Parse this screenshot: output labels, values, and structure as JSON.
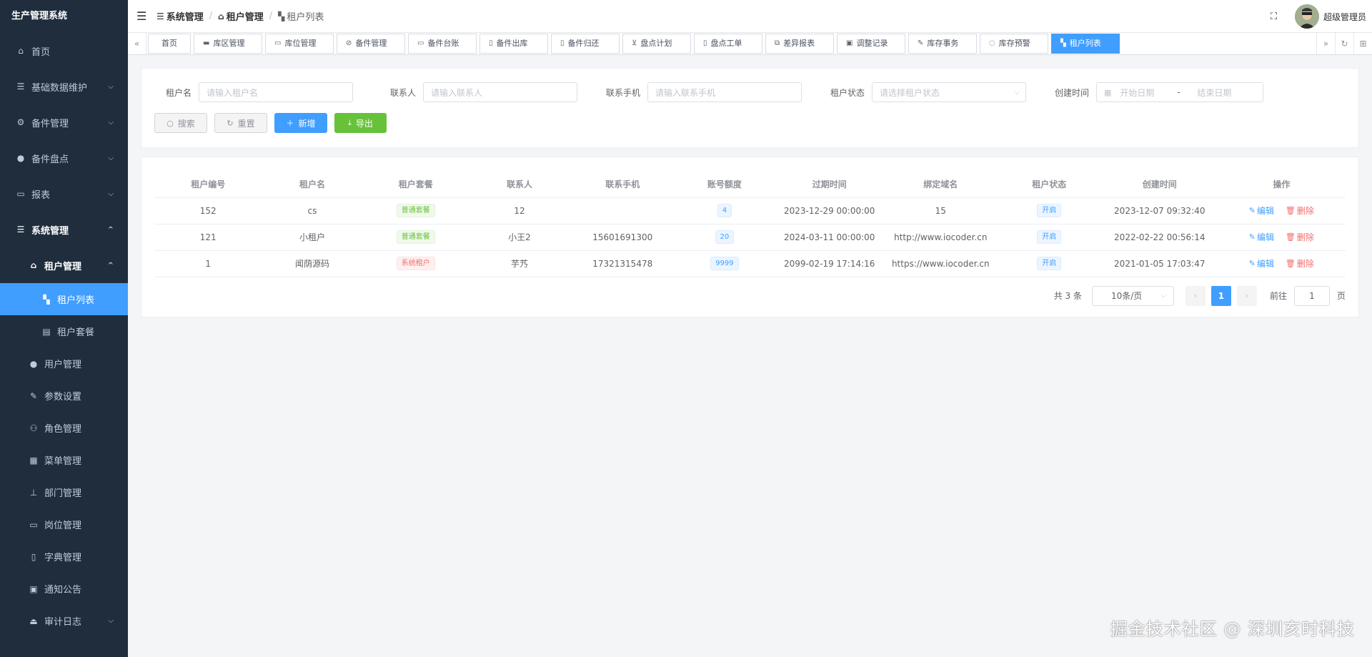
{
  "app": {
    "title": "生产管理系统"
  },
  "sidebar": {
    "items": [
      {
        "label": "首页",
        "icon": "home-icon"
      },
      {
        "label": "基础数据维护",
        "icon": "list-icon"
      },
      {
        "label": "备件管理",
        "icon": "spare-parts-icon"
      },
      {
        "label": "备件盘点",
        "icon": "user-icon"
      },
      {
        "label": "报表",
        "icon": "cart-icon"
      },
      {
        "label": "系统管理",
        "icon": "list-icon"
      }
    ],
    "system_sub": [
      {
        "label": "租户管理",
        "icon": "house-icon"
      },
      {
        "label": "租户列表",
        "icon": "peoples-icon"
      },
      {
        "label": "租户套餐",
        "icon": "clipboard-icon"
      },
      {
        "label": "用户管理",
        "icon": "user-icon"
      },
      {
        "label": "参数设置",
        "icon": "edit-icon"
      },
      {
        "label": "角色管理",
        "icon": "peoples-icon"
      },
      {
        "label": "菜单管理",
        "icon": "tree-table-icon"
      },
      {
        "label": "部门管理",
        "icon": "tree-icon"
      },
      {
        "label": "岗位管理",
        "icon": "post-icon"
      },
      {
        "label": "字典管理",
        "icon": "dict-icon"
      },
      {
        "label": "通知公告",
        "icon": "message-icon"
      },
      {
        "label": "审计日志",
        "icon": "log-icon"
      }
    ]
  },
  "breadcrumb": [
    "系统管理",
    "租户管理",
    "租户列表"
  ],
  "user": {
    "name": "超级管理员"
  },
  "tags": [
    "首页",
    "库区管理",
    "库位管理",
    "备件管理",
    "备件台账",
    "备件出库",
    "备件归还",
    "盘点计划",
    "盘点工单",
    "差异报表",
    "调整记录",
    "库存事务",
    "库存预警",
    "租户列表"
  ],
  "search": {
    "name_label": "租户名",
    "name_placeholder": "请输入租户名",
    "contact_label": "联系人",
    "contact_placeholder": "请输入联系人",
    "mobile_label": "联系手机",
    "mobile_placeholder": "请输入联系手机",
    "status_label": "租户状态",
    "status_placeholder": "请选择租户状态",
    "created_label": "创建时间",
    "start_placeholder": "开始日期",
    "range_sep": "-",
    "end_placeholder": "结束日期"
  },
  "buttons": {
    "search": "搜索",
    "reset": "重置",
    "add": "新增",
    "export": "导出"
  },
  "table": {
    "headers": [
      "租户编号",
      "租户名",
      "租户套餐",
      "联系人",
      "联系手机",
      "账号额度",
      "过期时间",
      "绑定域名",
      "租户状态",
      "创建时间",
      "操作"
    ],
    "rows": [
      {
        "id": "152",
        "name": "cs",
        "package": "普通套餐",
        "package_type": "success",
        "contact": "12",
        "mobile": "",
        "quota": "4",
        "expire": "2023-12-29 00:00:00",
        "domain": "15",
        "status": "开启",
        "created": "2023-12-07 09:32:40"
      },
      {
        "id": "121",
        "name": "小租户",
        "package": "普通套餐",
        "package_type": "success",
        "contact": "小王2",
        "mobile": "15601691300",
        "quota": "20",
        "expire": "2024-03-11 00:00:00",
        "domain": "http://www.iocoder.cn",
        "status": "开启",
        "created": "2022-02-22 00:56:14"
      },
      {
        "id": "1",
        "name": "闻荫源码",
        "package": "系统租户",
        "package_type": "danger",
        "contact": "芋艿",
        "mobile": "17321315478",
        "quota": "9999",
        "expire": "2099-02-19 17:14:16",
        "domain": "https://www.iocoder.cn",
        "status": "开启",
        "created": "2021-01-05 17:03:47"
      }
    ],
    "edit_label": "编辑",
    "delete_label": "删除"
  },
  "pagination": {
    "total": "共 3 条",
    "page_size": "10条/页",
    "current": "1",
    "goto": "前往",
    "goto_value": "1",
    "page_unit": "页"
  },
  "watermark": "掘金技术社区 @ 深圳亥时科技",
  "colors": {
    "sidebar_bg": "#1f2d3d",
    "primary": "#409eff",
    "success": "#67c23a",
    "danger": "#f56c6c"
  }
}
